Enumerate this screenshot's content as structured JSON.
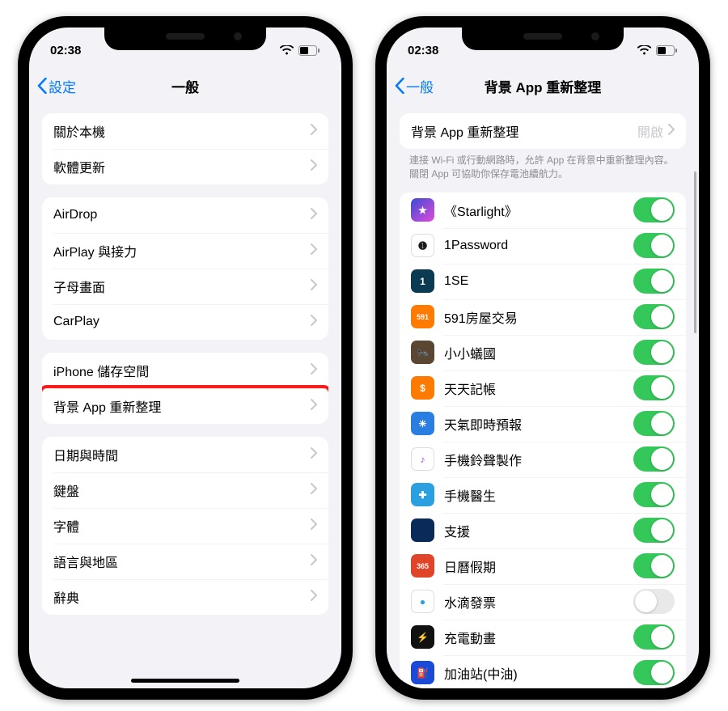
{
  "status": {
    "time": "02:38"
  },
  "left": {
    "back": "設定",
    "title": "一般",
    "groups": [
      {
        "rows": [
          {
            "label": "關於本機"
          },
          {
            "label": "軟體更新"
          }
        ]
      },
      {
        "rows": [
          {
            "label": "AirDrop"
          },
          {
            "label": "AirPlay 與接力"
          },
          {
            "label": "子母畫面"
          },
          {
            "label": "CarPlay"
          }
        ]
      },
      {
        "rows": [
          {
            "label": "iPhone 儲存空間"
          },
          {
            "label": "背景 App 重新整理",
            "highlight": true
          }
        ]
      },
      {
        "rows": [
          {
            "label": "日期與時間"
          },
          {
            "label": "鍵盤"
          },
          {
            "label": "字體"
          },
          {
            "label": "語言與地區"
          },
          {
            "label": "辭典"
          }
        ]
      }
    ]
  },
  "right": {
    "back": "一般",
    "title": "背景 App 重新整理",
    "main_row": {
      "label": "背景 App 重新整理",
      "value": "開啟"
    },
    "description": "連接 Wi-Fi 或行動網路時，允許 App 在背景中重新整理內容。關閉 App 可協助你保存電池續航力。",
    "apps": [
      {
        "name": "《Starlight》",
        "color": "linear-gradient(135deg,#3b4bd8,#e04bd8)",
        "glyph": "★",
        "on": true
      },
      {
        "name": "1Password",
        "color": "#fff",
        "glyph": "➊",
        "glyphColor": "#1a1a1a",
        "border": true,
        "on": true
      },
      {
        "name": "1SE",
        "color": "#0b3b52",
        "glyph": "1",
        "on": true
      },
      {
        "name": "591房屋交易",
        "color": "#ff7a00",
        "glyph": "591",
        "glyphSize": "9px",
        "on": true
      },
      {
        "name": "小小蟻國",
        "color": "#5a4632",
        "glyph": "🐜",
        "on": true
      },
      {
        "name": "天天記帳",
        "color": "#ff7a00",
        "glyph": "$",
        "on": true
      },
      {
        "name": "天氣即時預報",
        "color": "#2a7de1",
        "glyph": "☀",
        "on": true
      },
      {
        "name": "手機鈴聲製作",
        "color": "#fff",
        "glyph": "♪",
        "glyphColor": "#a14bd8",
        "border": true,
        "on": true
      },
      {
        "name": "手機醫生",
        "color": "#2aa0e1",
        "glyph": "✚",
        "on": true
      },
      {
        "name": "支援",
        "color": "#0a2a5a",
        "glyph": "",
        "on": true
      },
      {
        "name": "日曆假期",
        "color": "#e0452a",
        "glyph": "365",
        "glyphSize": "9px",
        "on": true
      },
      {
        "name": "水滴發票",
        "color": "#fff",
        "glyph": "●",
        "glyphColor": "#2aa0e1",
        "border": true,
        "on": false
      },
      {
        "name": "充電動畫",
        "color": "#111",
        "glyph": "⚡",
        "glyphColor": "#ffcf2a",
        "on": true
      },
      {
        "name": "加油站(中油)",
        "color": "#1a4bd8",
        "glyph": "⛽",
        "on": true
      }
    ]
  }
}
